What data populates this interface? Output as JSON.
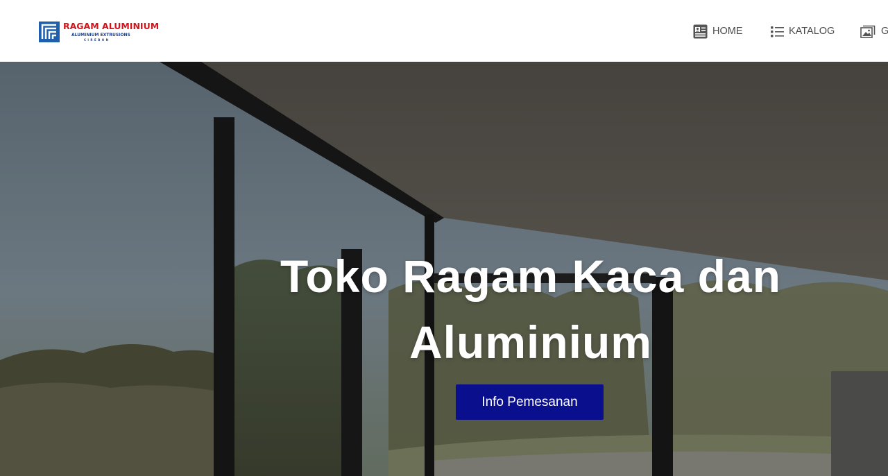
{
  "brand": {
    "name": "RAGAM ALUMINIUM",
    "tagline": "ALUMINIUM EXTRUSIONS",
    "city": "CIREBON",
    "colors": {
      "name": "#d3141c",
      "tagline": "#1b3f8f",
      "mark": "#1f5fae"
    }
  },
  "nav": {
    "items": [
      {
        "label": "HOME",
        "icon": "contact-card-icon"
      },
      {
        "label": "KATALOG",
        "icon": "list-icon"
      },
      {
        "label": "G",
        "icon": "gallery-icon"
      }
    ]
  },
  "hero": {
    "title": "Toko Ragam Kaca dan Aluminium",
    "button_label": "Info Pemesanan",
    "button_color": "#0a0f8e"
  }
}
